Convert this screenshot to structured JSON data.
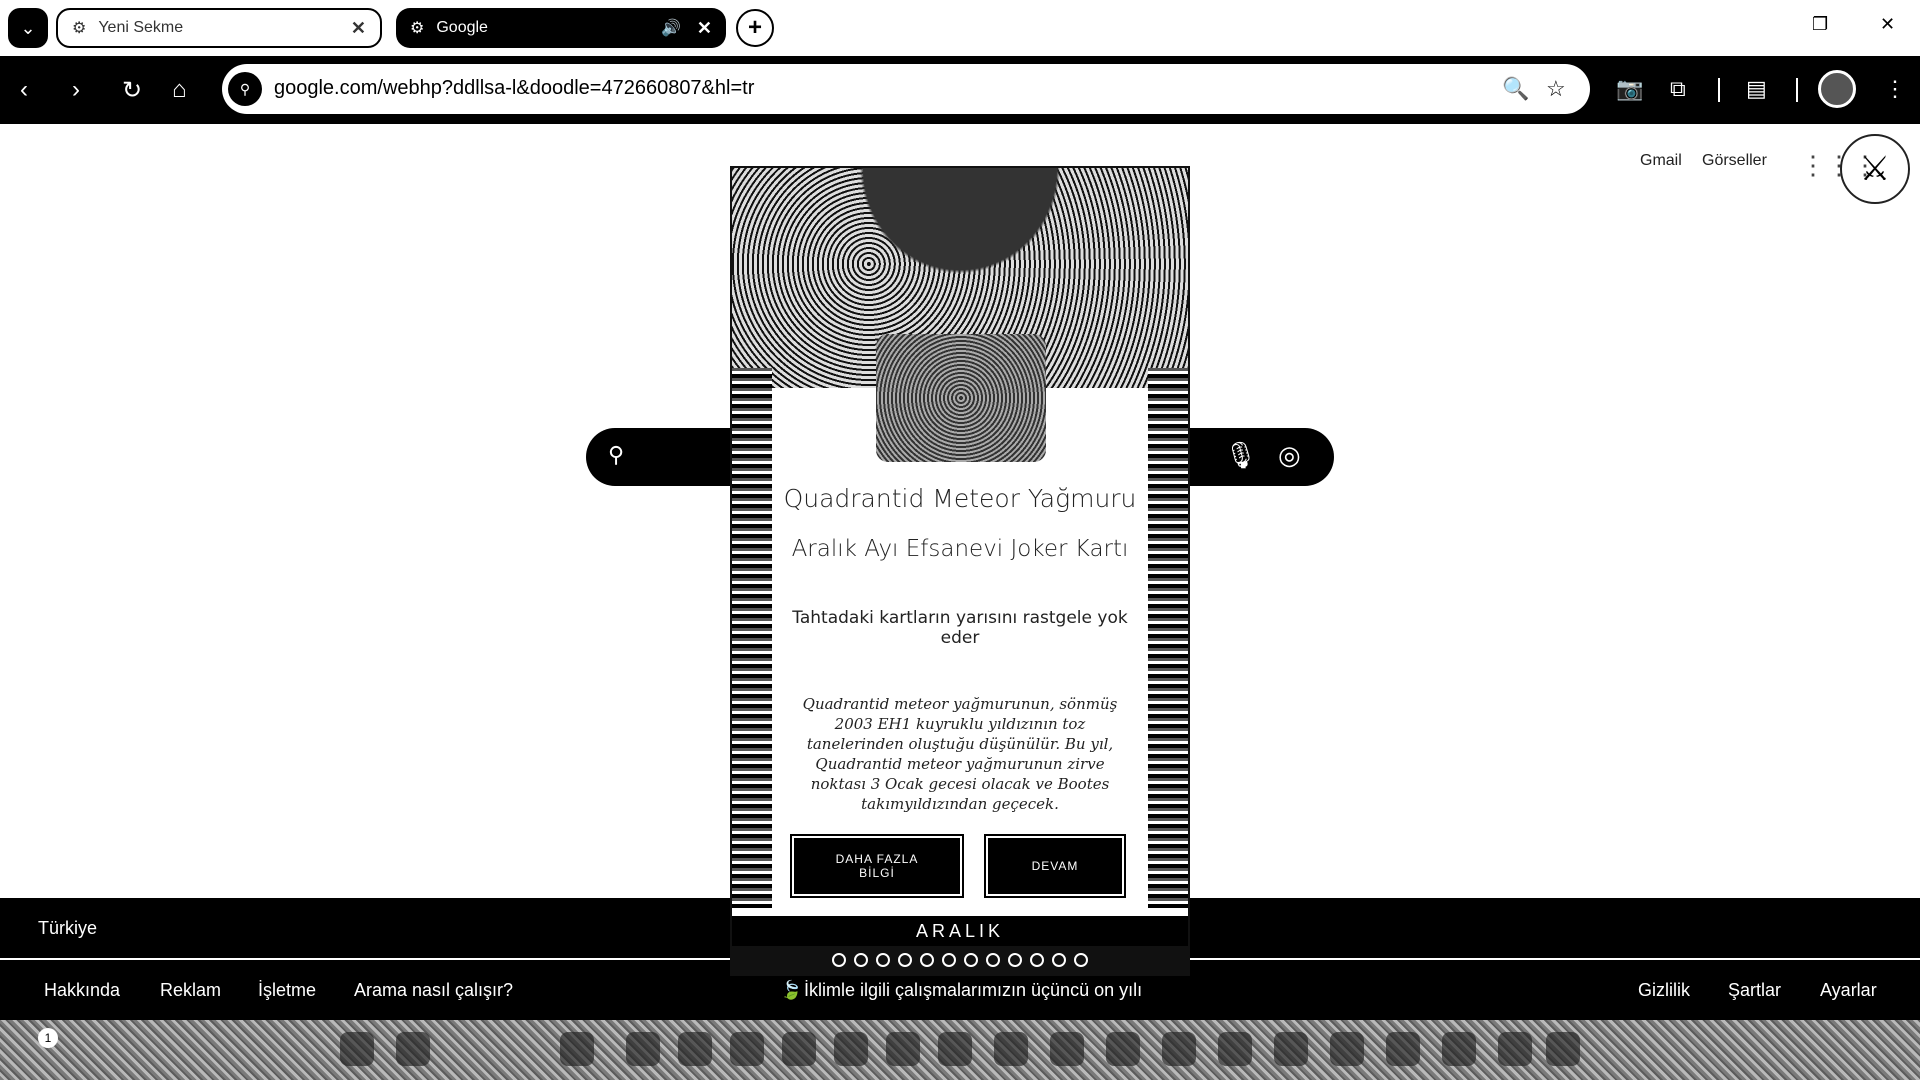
{
  "browser": {
    "tabs": [
      {
        "title": "Yeni Sekme",
        "active": false
      },
      {
        "title": "Google",
        "active": true
      }
    ],
    "address": "google.com/webhp?ddllsa-l&doodle=472660807&hl=tr"
  },
  "google": {
    "header_links": [
      "Gmail",
      "Görseller"
    ],
    "country": "Türkiye",
    "footer_left": [
      "Hakkında",
      "Reklam",
      "İşletme",
      "Arama nasıl çalışır?"
    ],
    "footer_center": "İklimle ilgili çalışmalarımızın üçüncü on yılı",
    "footer_right": [
      "Gizlilik",
      "Şartlar",
      "Ayarlar"
    ]
  },
  "card": {
    "title": "Quadrantid Meteor Yağmuru",
    "subtitle": "Aralık Ayı Efsanevi Joker Kartı",
    "effect": "Tahtadaki kartların yarısını rastgele yok eder",
    "description": "Quadrantid meteor yağmurunun, sönmüş 2003 EH1 kuyruklu yıldızının toz tanelerinden oluştuğu düşünülür. Bu yıl, Quadrantid meteor yağmurunun zirve noktası 3 Ocak gecesi olacak ve Bootes takımyıldızından geçecek.",
    "btn_more": "DAHA FAZLA BİLGİ",
    "btn_continue": "DEVAM",
    "month": "ARALIK"
  },
  "taskbar": {
    "badge": "1"
  }
}
